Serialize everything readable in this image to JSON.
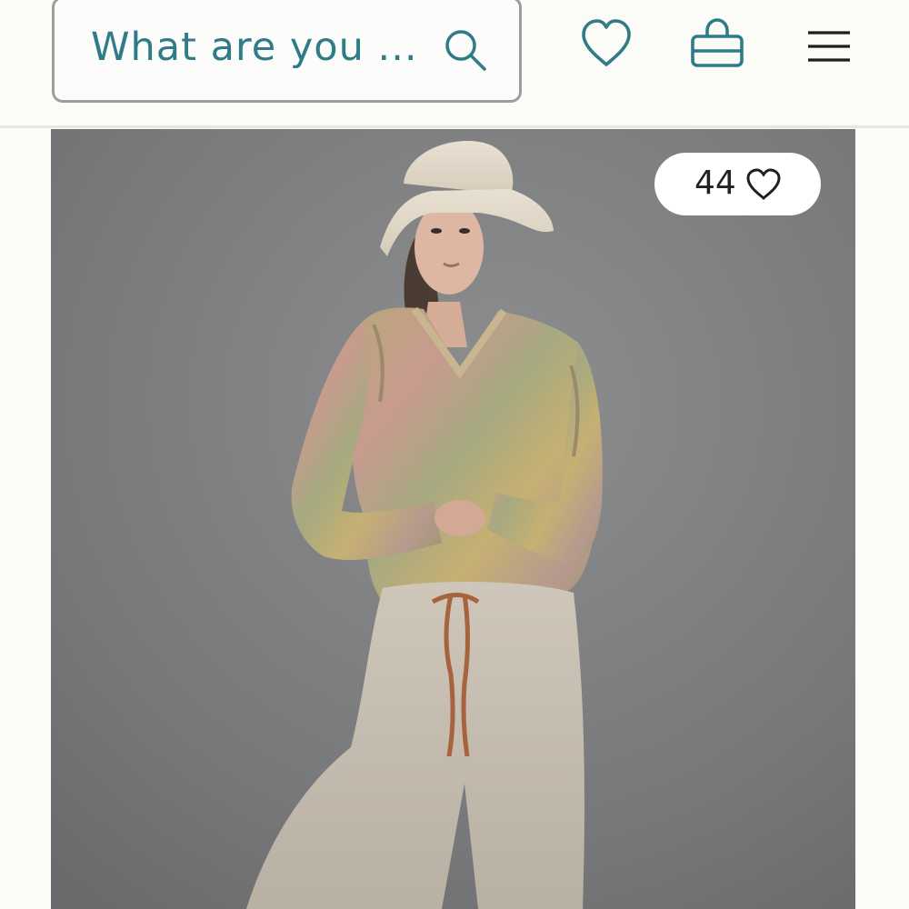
{
  "header": {
    "search": {
      "placeholder": "What are you ..."
    },
    "icons": {
      "search": "search-icon",
      "wishlist": "heart-icon",
      "bag": "shopping-bag-icon",
      "menu": "hamburger-menu-icon"
    }
  },
  "product": {
    "image_alt": "Model wearing pastel marled hooded sweater, bucket hat and oatmeal joggers",
    "likes": {
      "count": "44",
      "icon": "heart-outline-icon"
    }
  },
  "colors": {
    "accent": "#2f7b88",
    "background": "#fbfbf7",
    "photo_backdrop": "#7a7b7d"
  }
}
